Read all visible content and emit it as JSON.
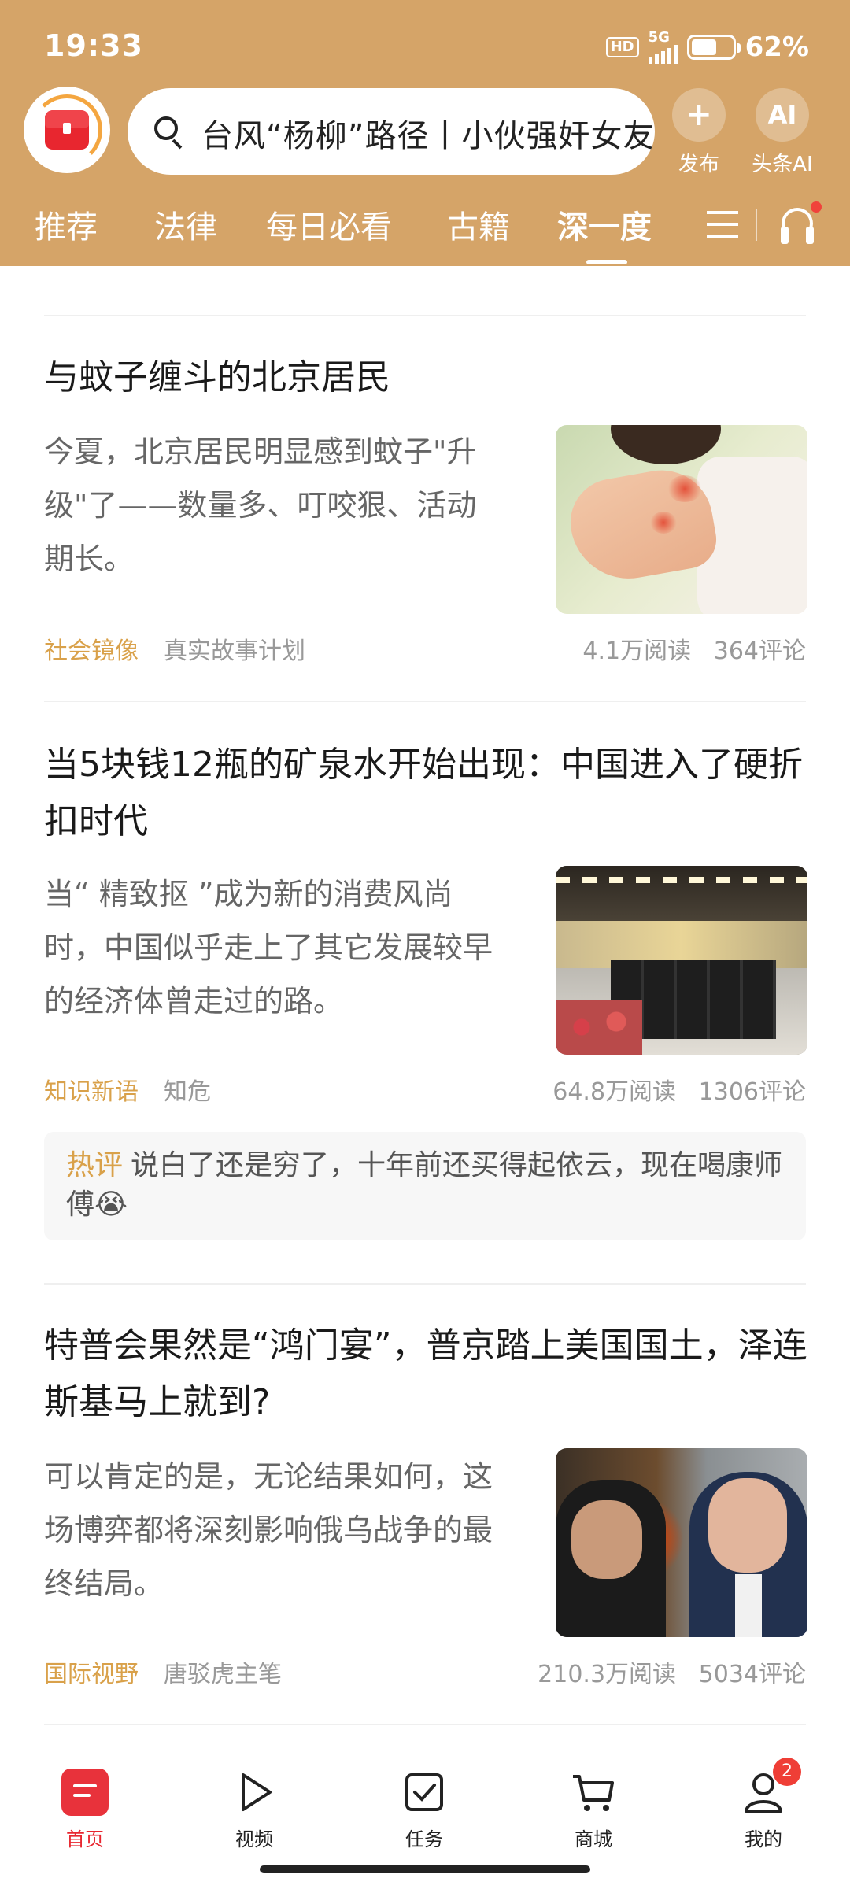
{
  "status_bar": {
    "time": "19:33",
    "hd": "HD",
    "network": "5G",
    "battery_percent": "62%",
    "battery_level": 0.62
  },
  "header": {
    "search_text": "台风“杨柳”路径丨小伙强奸女友",
    "publish_label": "发布",
    "ai_icon_text": "AI",
    "ai_label": "头条AI",
    "background_color": "#d5a468"
  },
  "tabs": [
    {
      "label": "推荐"
    },
    {
      "label": "法律"
    },
    {
      "label": "每日必看"
    },
    {
      "label": "古籍"
    },
    {
      "label": "深一度",
      "active": true
    }
  ],
  "articles": [
    {
      "title": "与蚊子缠斗的北京居民",
      "summary": "今夏，北京居民明显感到蚊子\"升级\"了——数量多、叮咬狠、活动期长。",
      "category": "社会镜像",
      "author": "真实故事计划",
      "reads": "4.1万阅读",
      "comments": "364评论"
    },
    {
      "title": "当5块钱12瓶的矿泉水开始出现：中国进入了硬折扣时代",
      "summary": "当“ 精致抠 ”成为新的消费风尚时，中国似乎走上了其它发展较早的经济体曾走过的路。",
      "category": "知识新语",
      "author": "知危",
      "reads": "64.8万阅读",
      "comments": "1306评论",
      "hot_comment_tag": "热评",
      "hot_comment": "说白了还是穷了，十年前还买得起依云，现在喝康师傅😭"
    },
    {
      "title": "特普会果然是“鸿门宴”，普京踏上美国国土，泽连斯基马上就到?",
      "summary": "可以肯定的是，无论结果如何，这场博弈都将深刻影响俄乌战争的最终结局。",
      "category": "国际视野",
      "author": "唐驳虎主笔",
      "reads": "210.3万阅读",
      "comments": "5034评论"
    }
  ],
  "bottom_nav": [
    {
      "label": "首页",
      "icon": "home-icon",
      "active": true
    },
    {
      "label": "视频",
      "icon": "play-icon"
    },
    {
      "label": "任务",
      "icon": "task-check-icon"
    },
    {
      "label": "商城",
      "icon": "cart-icon"
    },
    {
      "label": "我的",
      "icon": "profile-icon",
      "badge": "2"
    }
  ],
  "colors": {
    "accent_gold": "#d9a14a",
    "brand_red": "#e8262f"
  }
}
